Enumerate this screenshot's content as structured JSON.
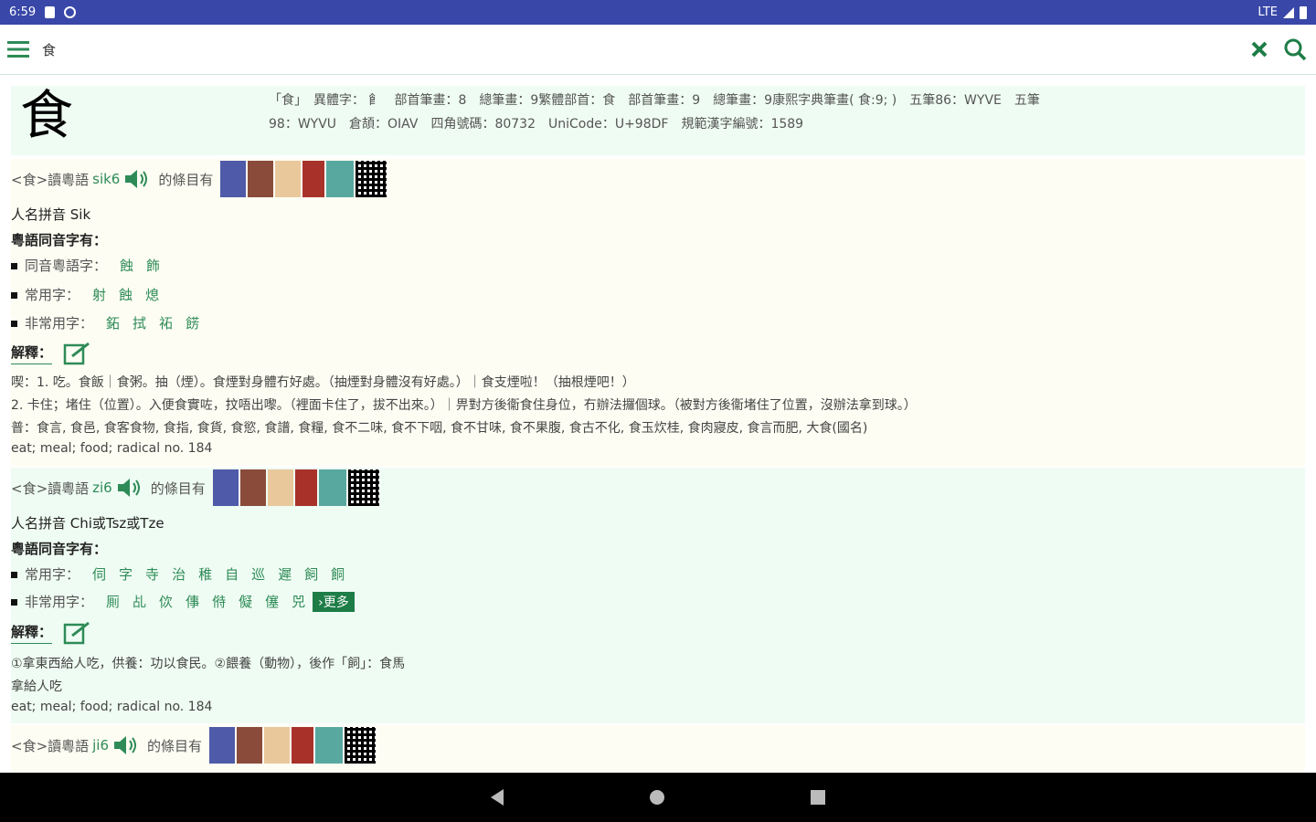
{
  "status": {
    "time": "6:59",
    "network": "LTE"
  },
  "toolbar": {
    "query": "食"
  },
  "entry": {
    "char": "食",
    "meta_line1": "「食」　異體字：𩚁 𩙿　部首筆畫：8　總筆畫：9繁體部首：食　部首筆畫：9　總筆畫：9康熙字典筆畫( 食:9; )　五筆86：WYVE　五筆",
    "meta_line2": "98：WYVU　倉頡：OIAV　四角號碼：80732　UniCode：U+98DF　規範漢字編號：1589"
  },
  "sections": [
    {
      "prefix": "<食>讀粵語",
      "jyutping": "sik6",
      "suffix": "的條目有",
      "name_pinyin": "人名拼音 Sik",
      "homophone_title": "粵語同音字有：",
      "homophone_label": "同音粵語字：",
      "homophones": [
        "蝕",
        "飾"
      ],
      "common_label": "常用字：",
      "common": [
        "射",
        "蝕",
        "熄"
      ],
      "rare_label": "非常用字：",
      "rare": [
        "鉐",
        "拭",
        "祏",
        "餝"
      ],
      "explain_label": "解釋：",
      "defs": [
        "喫：1. 吃。食飯｜食粥。抽（煙）。食煙對身體冇好處。（抽煙對身體沒有好處。）｜食支煙啦！（抽根煙吧！）",
        "2. 卡住；堵住（位置）。入便食實咗，抆唔出嚟。（裡面卡住了，拔不出來。）｜畀對方後衞食住身位，冇辦法攞個球。（被對方後衞堵住了位置，沒辦法拿到球。）",
        "普：食言, 食邑, 食客食物, 食指, 食貨, 食慾, 食譜, 食糧, 食不二味, 食不下咽, 食不甘味, 食不果腹, 食古不化, 食玉炊桂, 食肉寢皮, 食言而肥, 大食(國名)",
        "eat; meal; food; radical no. 184"
      ]
    },
    {
      "prefix": "<食>讀粵語",
      "jyutping": "zi6",
      "suffix": "的條目有",
      "name_pinyin": "人名拼音 Chi或Tsz或Tze",
      "homophone_title": "粵語同音字有：",
      "common_label": "常用字：",
      "common": [
        "伺",
        "字",
        "寺",
        "治",
        "稚",
        "自",
        "巡",
        "遲",
        "飼",
        "餇"
      ],
      "rare_label": "非常用字：",
      "rare": [
        "厠",
        "乩",
        "佽",
        "倳",
        "偫",
        "儗",
        "僿",
        "兕"
      ],
      "more_label": "更多",
      "explain_label": "解釋：",
      "defs": [
        "①拿東西給人吃，供養：功以食民。②餵養（動物），後作「飼」：食馬",
        "拿給人吃",
        "eat; meal; food; radical no. 184"
      ]
    },
    {
      "prefix": "<食>讀粵語",
      "jyutping": "ji6",
      "suffix": "的條目有"
    }
  ],
  "colors": {
    "statusbar": "#3947a8",
    "accent": "#2e8b57",
    "light_green": "#effcf3",
    "light_yellow": "#fdfdf3"
  }
}
